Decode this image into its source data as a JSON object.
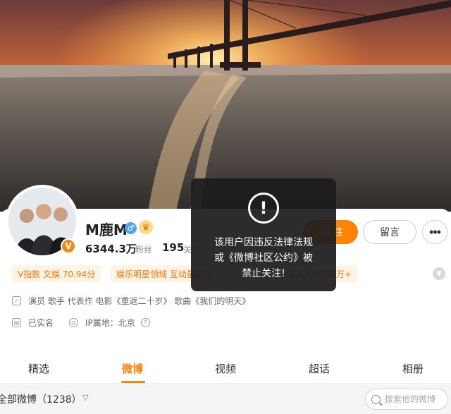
{
  "profile": {
    "name": "M鹿M",
    "verified_badge": "V",
    "followers_count": "6344.3万",
    "followers_label": "粉丝",
    "following_count": "195",
    "following_label": "关注",
    "gender_icon": "male-icon",
    "crown_icon": "crown-icon"
  },
  "actions": {
    "follow_label": "+关注",
    "message_label": "留言",
    "more_label": "•••"
  },
  "tags": [
    {
      "label": "V指数 文娱 70.94分"
    },
    {
      "label": "娱乐明星领域 互动量提升"
    },
    {
      "label": "阅读人数100万+"
    }
  ],
  "info": {
    "bio": "演员 歌手 代表作 电影《重返二十岁》 歌曲《我们的明天》",
    "real_name": "已实名",
    "ip_location": "IP属地：北京"
  },
  "tabs": [
    {
      "label": "精选"
    },
    {
      "label": "微博"
    },
    {
      "label": "视频"
    },
    {
      "label": "超话"
    },
    {
      "label": "相册"
    }
  ],
  "filter": {
    "label": "全部微博（1238）",
    "search_placeholder": "搜索他的微博"
  },
  "notice": {
    "line1": "该用户因违反法律法规",
    "line2": "或《微博社区公约》被",
    "line3": "禁止关注!",
    "icon": "warning-icon"
  },
  "colors": {
    "accent": "#ff8200",
    "toast_bg": "#1c1c1e",
    "tag_bg": "#fff3e4"
  }
}
